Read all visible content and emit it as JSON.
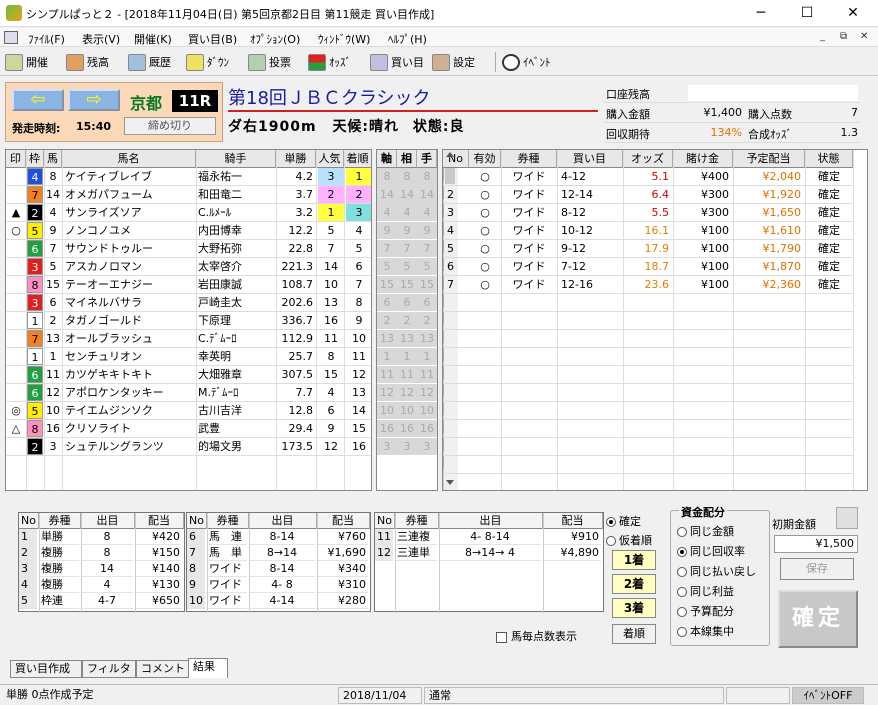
{
  "window": {
    "title": "シンプルぱっと２ - [2018年11月04日(日) 第5回京都2日目 第11競走 買い目作成]",
    "min": "─",
    "max": "☐",
    "close": "✕"
  },
  "menu": [
    "ﾌｧｲﾙ(F)",
    "表示(V)",
    "開催(K)",
    "買い目(B)",
    "ｵﾌﾟｼｮﾝ(O)",
    "ｳｨﾝﾄﾞｳ(W)",
    "ﾍﾙﾌﾟ(H)"
  ],
  "mdi": [
    "_",
    "⧉",
    "✕"
  ],
  "toolbar": [
    "開催",
    "残高",
    "厩歴",
    "ﾀﾞｳﾝ",
    "投票",
    "ｵｯｽﾞ",
    "買い目",
    "設定",
    "ｲﾍﾞﾝﾄ"
  ],
  "race": {
    "prev": "⇦",
    "next": "⇨",
    "venue": "京都",
    "race_no": "11R",
    "start_label": "発走時刻:",
    "start_time": "15:40",
    "close_button": "締め切り",
    "name": "第18回ＪＢＣクラシック",
    "course": "ダ右1900m",
    "weather_label": "天候:",
    "weather": "晴れ",
    "going_label": "状態:",
    "going": "良"
  },
  "summary": {
    "account_label": "口座残高",
    "account_value": "",
    "buy_amount_label": "購入金額",
    "buy_amount": "¥1,400",
    "buy_points_label": "購入点数",
    "buy_points": "7",
    "expect_label": "回収期待",
    "expect": "134%",
    "odds_label": "合成ｵｯｽﾞ",
    "odds": "1.3"
  },
  "horse_headers": [
    "印",
    "枠",
    "馬",
    "馬名",
    "騎手",
    "単勝",
    "人気",
    "着順"
  ],
  "wheel_headers": [
    "軸",
    "相",
    "手"
  ],
  "horses": [
    {
      "mark": "",
      "waku": "4",
      "no": "8",
      "name": "ケイティブレイブ",
      "jockey": "福永祐一",
      "odds": "4.2",
      "pop": "3",
      "finish": "1",
      "pop_color": "#b8e0ff",
      "fin_color": "#ffff40",
      "wheel": "8"
    },
    {
      "mark": "",
      "waku": "7",
      "no": "14",
      "name": "オメガパフューム",
      "jockey": "和田竜二",
      "odds": "3.7",
      "pop": "2",
      "finish": "2",
      "pop_color": "#ffb0ff",
      "fin_color": "#ffb0ff",
      "wheel": "14"
    },
    {
      "mark": "▲",
      "waku": "2",
      "no": "4",
      "name": "サンライズソア",
      "jockey": "C.ﾙﾒｰﾙ",
      "odds": "3.2",
      "pop": "1",
      "finish": "3",
      "pop_color": "#ffff40",
      "fin_color": "#80e0e0",
      "wheel": "4"
    },
    {
      "mark": "○",
      "waku": "5",
      "no": "9",
      "name": "ノンコノユメ",
      "jockey": "内田博幸",
      "odds": "12.2",
      "pop": "5",
      "finish": "4",
      "pop_color": "",
      "fin_color": "",
      "wheel": "9"
    },
    {
      "mark": "",
      "waku": "6",
      "no": "7",
      "name": "サウンドトゥルー",
      "jockey": "大野拓弥",
      "odds": "22.8",
      "pop": "7",
      "finish": "5",
      "pop_color": "",
      "fin_color": "",
      "wheel": "7"
    },
    {
      "mark": "",
      "waku": "3",
      "no": "5",
      "name": "アスカノロマン",
      "jockey": "太宰啓介",
      "odds": "221.3",
      "pop": "14",
      "finish": "6",
      "pop_color": "",
      "fin_color": "",
      "wheel": "5"
    },
    {
      "mark": "",
      "waku": "8",
      "no": "15",
      "name": "テーオーエナジー",
      "jockey": "岩田康誠",
      "odds": "108.7",
      "pop": "10",
      "finish": "7",
      "pop_color": "",
      "fin_color": "",
      "wheel": "15"
    },
    {
      "mark": "",
      "waku": "3",
      "no": "6",
      "name": "マイネルバサラ",
      "jockey": "戸崎圭太",
      "odds": "202.6",
      "pop": "13",
      "finish": "8",
      "pop_color": "",
      "fin_color": "",
      "wheel": "6"
    },
    {
      "mark": "",
      "waku": "1",
      "no": "2",
      "name": "タガノゴールド",
      "jockey": "下原理",
      "odds": "336.7",
      "pop": "16",
      "finish": "9",
      "pop_color": "",
      "fin_color": "",
      "wheel": "2"
    },
    {
      "mark": "",
      "waku": "7",
      "no": "13",
      "name": "オールブラッシュ",
      "jockey": "C.ﾃﾞﾑｰﾛ",
      "odds": "112.9",
      "pop": "11",
      "finish": "10",
      "pop_color": "",
      "fin_color": "",
      "wheel": "13"
    },
    {
      "mark": "",
      "waku": "1",
      "no": "1",
      "name": "センチュリオン",
      "jockey": "幸英明",
      "odds": "25.7",
      "pop": "8",
      "finish": "11",
      "pop_color": "",
      "fin_color": "",
      "wheel": "1"
    },
    {
      "mark": "",
      "waku": "6",
      "no": "11",
      "name": "カツゲキキトキト",
      "jockey": "大畑雅章",
      "odds": "307.5",
      "pop": "15",
      "finish": "12",
      "pop_color": "",
      "fin_color": "",
      "wheel": "11"
    },
    {
      "mark": "",
      "waku": "6",
      "no": "12",
      "name": "アポロケンタッキー",
      "jockey": "M.ﾃﾞﾑｰﾛ",
      "odds": "7.7",
      "pop": "4",
      "finish": "13",
      "pop_color": "",
      "fin_color": "",
      "wheel": "12"
    },
    {
      "mark": "◎",
      "waku": "5",
      "no": "10",
      "name": "テイエムジンソク",
      "jockey": "古川吉洋",
      "odds": "12.8",
      "pop": "6",
      "finish": "14",
      "pop_color": "",
      "fin_color": "",
      "wheel": "10"
    },
    {
      "mark": "△",
      "waku": "8",
      "no": "16",
      "name": "クリソライト",
      "jockey": "武豊",
      "odds": "29.4",
      "pop": "9",
      "finish": "15",
      "pop_color": "",
      "fin_color": "",
      "wheel": "16"
    },
    {
      "mark": "",
      "waku": "2",
      "no": "3",
      "name": "シュテルングランツ",
      "jockey": "的場文男",
      "odds": "173.5",
      "pop": "12",
      "finish": "16",
      "pop_color": "",
      "fin_color": "",
      "wheel": "3"
    }
  ],
  "waku_colors": {
    "1": [
      "#ffffff",
      "#000"
    ],
    "2": [
      "#000000",
      "#fff"
    ],
    "3": [
      "#e02020",
      "#fff"
    ],
    "4": [
      "#2050e0",
      "#fff"
    ],
    "5": [
      "#ffee00",
      "#000"
    ],
    "6": [
      "#20a040",
      "#fff"
    ],
    "7": [
      "#f08020",
      "#000"
    ],
    "8": [
      "#ff90c0",
      "#000"
    ]
  },
  "bet_headers": [
    "No",
    "有効",
    "券種",
    "買い目",
    "オッズ",
    "賭け金",
    "予定配当",
    "状態"
  ],
  "bets": [
    {
      "no": "1",
      "valid": "○",
      "type": "ワイド",
      "combo": "4-12",
      "odds": "5.1",
      "stake": "¥400",
      "payout": "¥2,040",
      "status": "確定",
      "odds_color": "#d00000"
    },
    {
      "no": "2",
      "valid": "○",
      "type": "ワイド",
      "combo": "12-14",
      "odds": "6.4",
      "stake": "¥300",
      "payout": "¥1,920",
      "status": "確定",
      "odds_color": "#d00000"
    },
    {
      "no": "3",
      "valid": "○",
      "type": "ワイド",
      "combo": "8-12",
      "odds": "5.5",
      "stake": "¥300",
      "payout": "¥1,650",
      "status": "確定",
      "odds_color": "#d00000"
    },
    {
      "no": "4",
      "valid": "○",
      "type": "ワイド",
      "combo": "10-12",
      "odds": "16.1",
      "stake": "¥100",
      "payout": "¥1,610",
      "status": "確定",
      "odds_color": "#e08000"
    },
    {
      "no": "5",
      "valid": "○",
      "type": "ワイド",
      "combo": "9-12",
      "odds": "17.9",
      "stake": "¥100",
      "payout": "¥1,790",
      "status": "確定",
      "odds_color": "#e08000"
    },
    {
      "no": "6",
      "valid": "○",
      "type": "ワイド",
      "combo": "7-12",
      "odds": "18.7",
      "stake": "¥100",
      "payout": "¥1,870",
      "status": "確定",
      "odds_color": "#e08000"
    },
    {
      "no": "7",
      "valid": "○",
      "type": "ワイド",
      "combo": "12-16",
      "odds": "23.6",
      "stake": "¥100",
      "payout": "¥2,360",
      "status": "確定",
      "odds_color": "#e08000"
    }
  ],
  "payout_headers": [
    "No",
    "券種",
    "出目",
    "配当"
  ],
  "payouts_a": [
    {
      "no": "1",
      "type": "単勝",
      "combo": "8",
      "pay": "¥420"
    },
    {
      "no": "2",
      "type": "複勝",
      "combo": "8",
      "pay": "¥150"
    },
    {
      "no": "3",
      "type": "複勝",
      "combo": "14",
      "pay": "¥140"
    },
    {
      "no": "4",
      "type": "複勝",
      "combo": "4",
      "pay": "¥130"
    },
    {
      "no": "5",
      "type": "枠連",
      "combo": "4-7",
      "pay": "¥650"
    }
  ],
  "payouts_b": [
    {
      "no": "6",
      "type": "馬　連",
      "combo": "8-14",
      "pay": "¥760"
    },
    {
      "no": "7",
      "type": "馬　単",
      "combo": "8→14",
      "pay": "¥1,690"
    },
    {
      "no": "8",
      "type": "ワイド",
      "combo": "8-14",
      "pay": "¥340"
    },
    {
      "no": "9",
      "type": "ワイド",
      "combo": "4- 8",
      "pay": "¥310"
    },
    {
      "no": "10",
      "type": "ワイド",
      "combo": "4-14",
      "pay": "¥280"
    }
  ],
  "payouts_c": [
    {
      "no": "11",
      "type": "三連複",
      "combo": "4- 8-14",
      "pay": "¥910"
    },
    {
      "no": "12",
      "type": "三連単",
      "combo": "8→14→ 4",
      "pay": "¥4,890"
    }
  ],
  "result_ctrl": {
    "confirmed": "確定",
    "provisional": "仮着順",
    "first": "1着",
    "second": "2着",
    "third": "3着",
    "order": "着順",
    "points_check": "馬毎点数表示"
  },
  "fund": {
    "title": "資金配分",
    "options": [
      "同じ金額",
      "同じ回収率",
      "同じ払い戻し",
      "同じ利益",
      "予算配分",
      "本線集中"
    ],
    "selected": 1,
    "initial_label": "初期金額",
    "initial_value": "¥1,500",
    "save": "保存",
    "confirm": "確定"
  },
  "tabs": [
    "買い目作成",
    "フィルタ",
    "コメント",
    "結果"
  ],
  "status": {
    "left": "単勝 0点作成予定",
    "date": "2018/11/04",
    "mode": "通常",
    "event": "ｲﾍﾞﾝﾄOFF"
  }
}
